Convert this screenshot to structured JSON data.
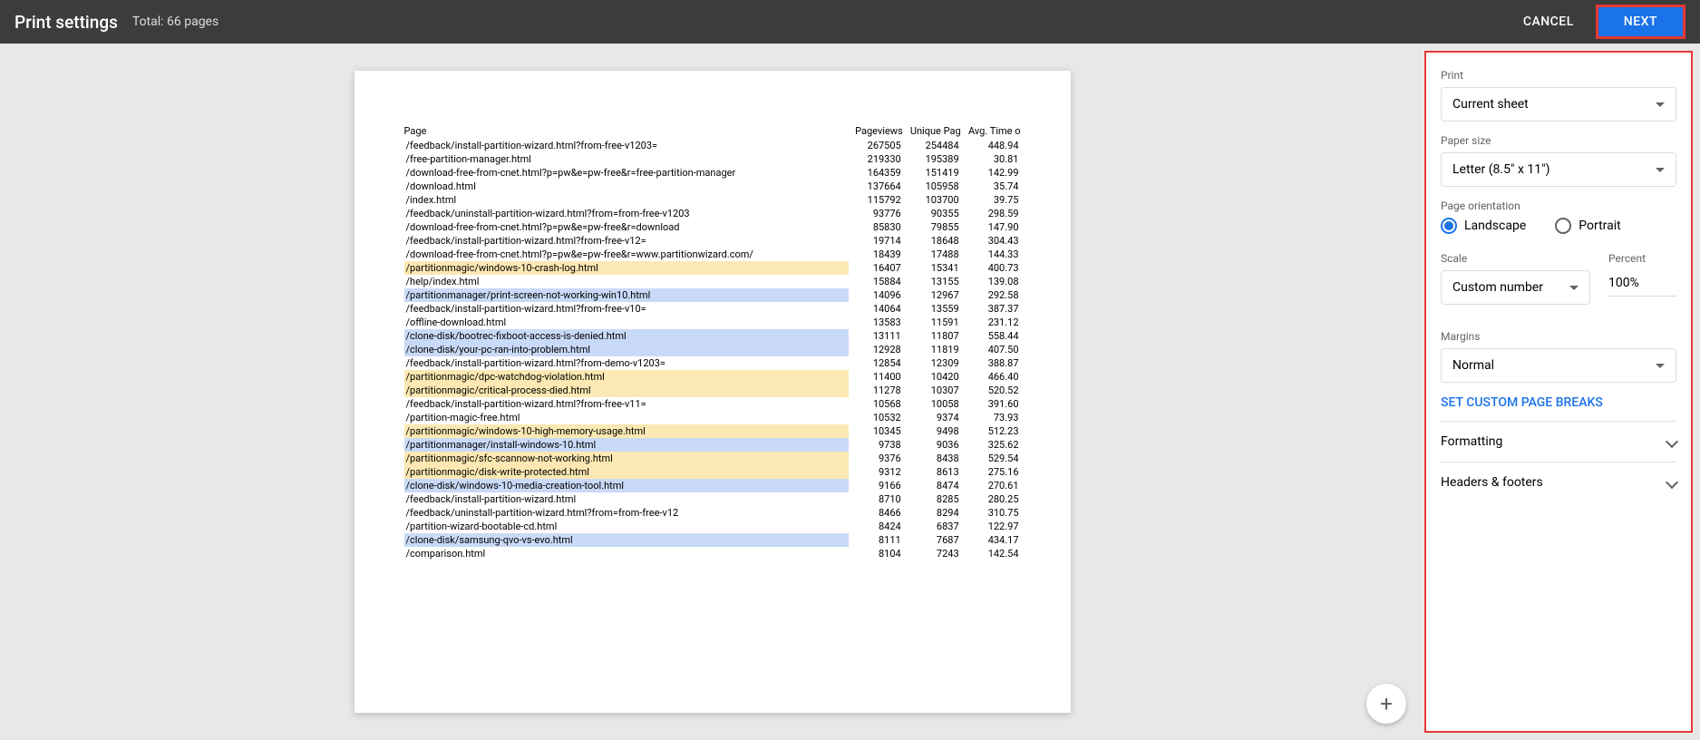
{
  "header": {
    "title": "Print settings",
    "total": "Total: 66 pages",
    "cancel": "CANCEL",
    "next": "NEXT"
  },
  "preview": {
    "columns": [
      "Page",
      "Pageviews",
      "Unique Pag",
      "Avg. Time o"
    ],
    "rows": [
      {
        "page": "/feedback/install-partition-wizard.html?from-free-v1203=",
        "pv": "267505",
        "upv": "254484",
        "t": "448.94",
        "hl": ""
      },
      {
        "page": "/free-partition-manager.html",
        "pv": "219330",
        "upv": "195389",
        "t": "30.81",
        "hl": ""
      },
      {
        "page": "/download-free-from-cnet.html?p=pw&e=pw-free&r=free-partition-manager",
        "pv": "164359",
        "upv": "151419",
        "t": "142.99",
        "hl": ""
      },
      {
        "page": "/download.html",
        "pv": "137664",
        "upv": "105958",
        "t": "35.74",
        "hl": ""
      },
      {
        "page": "/index.html",
        "pv": "115792",
        "upv": "103700",
        "t": "39.75",
        "hl": ""
      },
      {
        "page": "/feedback/uninstall-partition-wizard.html?from=from-free-v1203",
        "pv": "93776",
        "upv": "90355",
        "t": "298.59",
        "hl": ""
      },
      {
        "page": "/download-free-from-cnet.html?p=pw&e=pw-free&r=download",
        "pv": "85830",
        "upv": "79855",
        "t": "147.90",
        "hl": ""
      },
      {
        "page": "/feedback/install-partition-wizard.html?from-free-v12=",
        "pv": "19714",
        "upv": "18648",
        "t": "304.43",
        "hl": ""
      },
      {
        "page": "/download-free-from-cnet.html?p=pw&e=pw-free&r=www.partitionwizard.com/",
        "pv": "18439",
        "upv": "17488",
        "t": "144.33",
        "hl": ""
      },
      {
        "page": "/partitionmagic/windows-10-crash-log.html",
        "pv": "16407",
        "upv": "15341",
        "t": "400.73",
        "hl": "yellow"
      },
      {
        "page": "/help/index.html",
        "pv": "15884",
        "upv": "13155",
        "t": "139.08",
        "hl": ""
      },
      {
        "page": "/partitionmanager/print-screen-not-working-win10.html",
        "pv": "14096",
        "upv": "12967",
        "t": "292.58",
        "hl": "blue"
      },
      {
        "page": "/feedback/install-partition-wizard.html?from-free-v10=",
        "pv": "14064",
        "upv": "13559",
        "t": "387.37",
        "hl": ""
      },
      {
        "page": "/offline-download.html",
        "pv": "13583",
        "upv": "11591",
        "t": "231.12",
        "hl": ""
      },
      {
        "page": "/clone-disk/bootrec-fixboot-access-is-denied.html",
        "pv": "13111",
        "upv": "11807",
        "t": "558.44",
        "hl": "blue"
      },
      {
        "page": "/clone-disk/your-pc-ran-into-problem.html",
        "pv": "12928",
        "upv": "11819",
        "t": "407.50",
        "hl": "blue"
      },
      {
        "page": "/feedback/install-partition-wizard.html?from-demo-v1203=",
        "pv": "12854",
        "upv": "12309",
        "t": "388.87",
        "hl": ""
      },
      {
        "page": "/partitionmagic/dpc-watchdog-violation.html",
        "pv": "11400",
        "upv": "10420",
        "t": "466.40",
        "hl": "yellow"
      },
      {
        "page": "/partitionmagic/critical-process-died.html",
        "pv": "11278",
        "upv": "10307",
        "t": "520.52",
        "hl": "yellow"
      },
      {
        "page": "/feedback/install-partition-wizard.html?from-free-v11=",
        "pv": "10568",
        "upv": "10058",
        "t": "391.60",
        "hl": ""
      },
      {
        "page": "/partition-magic-free.html",
        "pv": "10532",
        "upv": "9374",
        "t": "73.93",
        "hl": ""
      },
      {
        "page": "/partitionmagic/windows-10-high-memory-usage.html",
        "pv": "10345",
        "upv": "9498",
        "t": "512.23",
        "hl": "yellow"
      },
      {
        "page": "/partitionmanager/install-windows-10.html",
        "pv": "9738",
        "upv": "9036",
        "t": "325.62",
        "hl": "blue"
      },
      {
        "page": "/partitionmagic/sfc-scannow-not-working.html",
        "pv": "9376",
        "upv": "8438",
        "t": "529.54",
        "hl": "yellow"
      },
      {
        "page": "/partitionmagic/disk-write-protected.html",
        "pv": "9312",
        "upv": "8613",
        "t": "275.16",
        "hl": "yellow"
      },
      {
        "page": "/clone-disk/windows-10-media-creation-tool.html",
        "pv": "9166",
        "upv": "8474",
        "t": "270.61",
        "hl": "blue"
      },
      {
        "page": "/feedback/install-partition-wizard.html",
        "pv": "8710",
        "upv": "8285",
        "t": "280.25",
        "hl": ""
      },
      {
        "page": "/feedback/uninstall-partition-wizard.html?from=from-free-v12",
        "pv": "8466",
        "upv": "8294",
        "t": "310.75",
        "hl": ""
      },
      {
        "page": "/partition-wizard-bootable-cd.html",
        "pv": "8424",
        "upv": "6837",
        "t": "122.97",
        "hl": ""
      },
      {
        "page": "/clone-disk/samsung-qvo-vs-evo.html",
        "pv": "8111",
        "upv": "7687",
        "t": "434.17",
        "hl": "blue"
      },
      {
        "page": "/comparison.html",
        "pv": "8104",
        "upv": "7243",
        "t": "142.54",
        "hl": ""
      }
    ]
  },
  "sidebar": {
    "print_label": "Print",
    "print_value": "Current sheet",
    "paper_label": "Paper size",
    "paper_value": "Letter (8.5\" x 11\")",
    "orient_label": "Page orientation",
    "landscape": "Landscape",
    "portrait": "Portrait",
    "scale_label": "Scale",
    "scale_value": "Custom number",
    "percent_label": "Percent",
    "percent_value": "100%",
    "margins_label": "Margins",
    "margins_value": "Normal",
    "page_breaks": "SET CUSTOM PAGE BREAKS",
    "formatting": "Formatting",
    "headers": "Headers & footers"
  }
}
